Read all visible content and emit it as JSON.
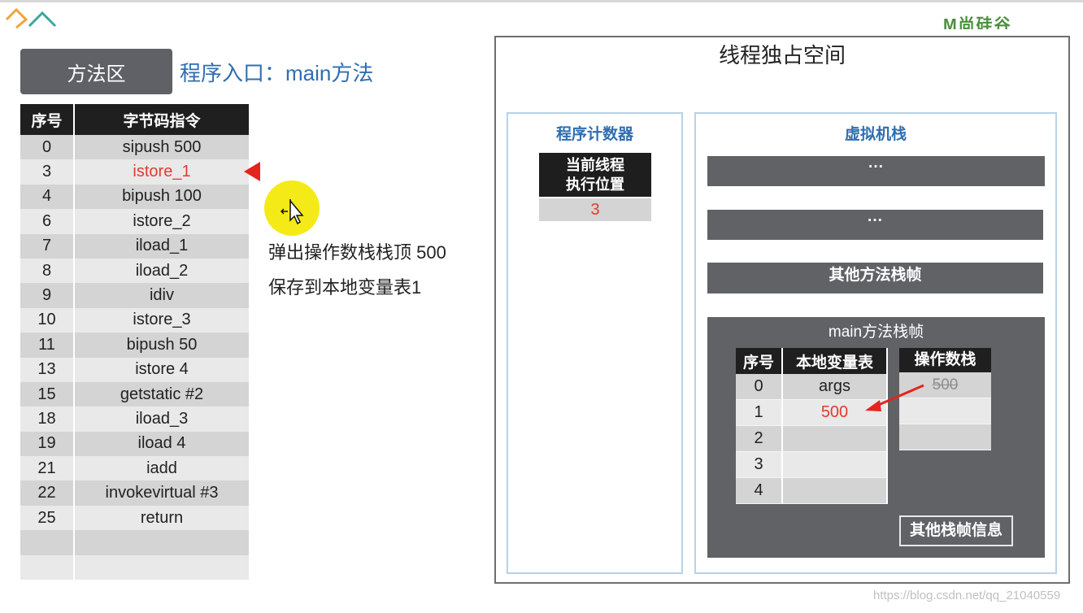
{
  "header": {
    "brand_logo_text": "M尚硅谷"
  },
  "method_area": {
    "label": "方法区",
    "entry_title": "程序入口：main方法",
    "table": {
      "columns": [
        "序号",
        "字节码指令"
      ],
      "rows": [
        {
          "seq": "0",
          "instr": "sipush 500"
        },
        {
          "seq": "3",
          "instr": "istore_1"
        },
        {
          "seq": "4",
          "instr": "bipush 100"
        },
        {
          "seq": "6",
          "instr": "istore_2"
        },
        {
          "seq": "7",
          "instr": "iload_1"
        },
        {
          "seq": "8",
          "instr": "iload_2"
        },
        {
          "seq": "9",
          "instr": "idiv"
        },
        {
          "seq": "10",
          "instr": "istore_3"
        },
        {
          "seq": "11",
          "instr": "bipush 50"
        },
        {
          "seq": "13",
          "instr": "istore 4"
        },
        {
          "seq": "15",
          "instr": "getstatic #2"
        },
        {
          "seq": "18",
          "instr": "iload_3"
        },
        {
          "seq": "19",
          "instr": "iload 4"
        },
        {
          "seq": "21",
          "instr": "iadd"
        },
        {
          "seq": "22",
          "instr": "invokevirtual #3"
        },
        {
          "seq": "25",
          "instr": "return"
        },
        {
          "seq": "",
          "instr": ""
        },
        {
          "seq": "",
          "instr": ""
        }
      ],
      "current_row_index": 1
    }
  },
  "notes": {
    "line1": "弹出操作数栈栈顶 500",
    "line2": "保存到本地变量表1"
  },
  "thread_space": {
    "title": "线程独占空间",
    "program_counter": {
      "title": "程序计数器",
      "header_line1": "当前线程",
      "header_line2": "执行位置",
      "value": "3"
    },
    "vm_stack": {
      "title": "虚拟机栈",
      "frame1": "···",
      "frame2": "···",
      "other_frames": "其他方法栈帧",
      "main_frame": {
        "title": "main方法栈帧",
        "locals_columns": [
          "序号",
          "本地变量表"
        ],
        "locals": [
          {
            "seq": "0",
            "value": "args"
          },
          {
            "seq": "1",
            "value": "500"
          },
          {
            "seq": "2",
            "value": ""
          },
          {
            "seq": "3",
            "value": ""
          },
          {
            "seq": "4",
            "value": ""
          }
        ],
        "operand_stack_title": "操作数栈",
        "operand_stack": [
          "500",
          "",
          ""
        ],
        "other_info": "其他栈帧信息"
      }
    }
  },
  "watermark": "https://blog.csdn.net/qq_21040559",
  "colors": {
    "accent_blue": "#2f6eb0",
    "highlight_red": "#e53a2f",
    "frame_gray": "#606265",
    "header_black": "#1f1f1f"
  }
}
